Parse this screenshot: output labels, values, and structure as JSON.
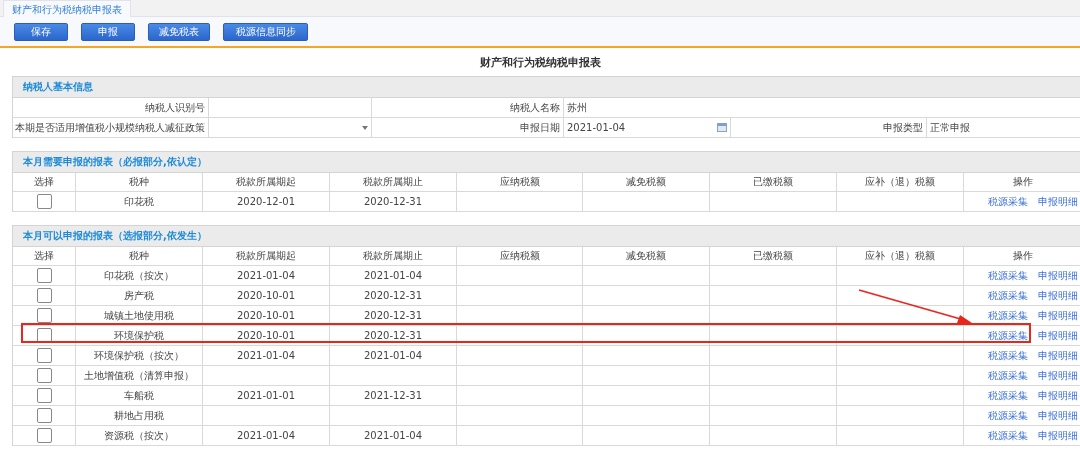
{
  "tab": {
    "label": "财产和行为税纳税申报表",
    "selected": true
  },
  "toolbar": {
    "buttons": [
      "保存",
      "申报",
      "减免税表",
      "税源信息同步"
    ]
  },
  "title": "财产和行为税纳税申报表",
  "basic_info": {
    "heading": "纳税人基本信息",
    "rows": [
      [
        {
          "kind": "label",
          "text": "纳税人识别号"
        },
        {
          "kind": "text"
        },
        {
          "kind": "label",
          "text": "纳税人名称"
        },
        {
          "kind": "text",
          "text": "苏州"
        }
      ],
      [
        {
          "kind": "label",
          "text": "本期是否适用增值税小规模纳税人减征政策"
        },
        {
          "kind": "select"
        },
        {
          "kind": "label",
          "text": "申报日期"
        },
        {
          "kind": "date",
          "text": "2021-01-04"
        },
        {
          "kind": "label",
          "text": "申报类型"
        },
        {
          "kind": "text",
          "text": "正常申报"
        }
      ]
    ]
  },
  "sections": [
    {
      "heading": "本月需要申报的报表（必报部分,依认定）",
      "columns": [
        "选择",
        "税种",
        "税款所属期起",
        "税款所属期止",
        "应纳税额",
        "减免税额",
        "已缴税额",
        "应补（退）税额",
        "操作"
      ],
      "rows": [
        {
          "checked": false,
          "annotated": false,
          "tax": "印花税",
          "start": "2020-12-01",
          "end": "2020-12-31",
          "actions": [
            "税源采集",
            "申报明细"
          ]
        }
      ]
    },
    {
      "heading": "本月可以申报的报表（选报部分,依发生）",
      "columns": [
        "选择",
        "税种",
        "税款所属期起",
        "税款所属期止",
        "应纳税额",
        "减免税额",
        "已缴税额",
        "应补（退）税额",
        "操作"
      ],
      "rows": [
        {
          "checked": false,
          "annotated": false,
          "tax": "印花税（按次）",
          "start": "2021-01-04",
          "end": "2021-01-04",
          "actions": [
            "税源采集",
            "申报明细"
          ]
        },
        {
          "checked": false,
          "annotated": false,
          "tax": "房产税",
          "start": "2020-10-01",
          "end": "2020-12-31",
          "actions": [
            "税源采集",
            "申报明细"
          ]
        },
        {
          "checked": false,
          "annotated": false,
          "tax": "城镇土地使用税",
          "start": "2020-10-01",
          "end": "2020-12-31",
          "actions": [
            "税源采集",
            "申报明细"
          ]
        },
        {
          "checked": false,
          "annotated": true,
          "tax": "环境保护税",
          "start": "2020-10-01",
          "end": "2020-12-31",
          "actions": [
            "税源采集",
            "申报明细"
          ]
        },
        {
          "checked": false,
          "annotated": false,
          "tax": "环境保护税（按次）",
          "start": "2021-01-04",
          "end": "2021-01-04",
          "actions": [
            "税源采集",
            "申报明细"
          ]
        },
        {
          "checked": false,
          "annotated": false,
          "tax": "土地增值税（清算申报）",
          "actions": [
            "税源采集",
            "申报明细"
          ]
        },
        {
          "checked": false,
          "annotated": false,
          "tax": "车船税",
          "start": "2021-01-01",
          "end": "2021-12-31",
          "actions": [
            "税源采集",
            "申报明细"
          ]
        },
        {
          "checked": false,
          "annotated": false,
          "tax": "耕地占用税",
          "actions": [
            "税源采集",
            "申报明细"
          ]
        },
        {
          "checked": false,
          "annotated": false,
          "tax": "资源税（按次）",
          "start": "2021-01-04",
          "end": "2021-01-04",
          "actions": [
            "税源采集",
            "申报明细"
          ]
        }
      ]
    }
  ]
}
